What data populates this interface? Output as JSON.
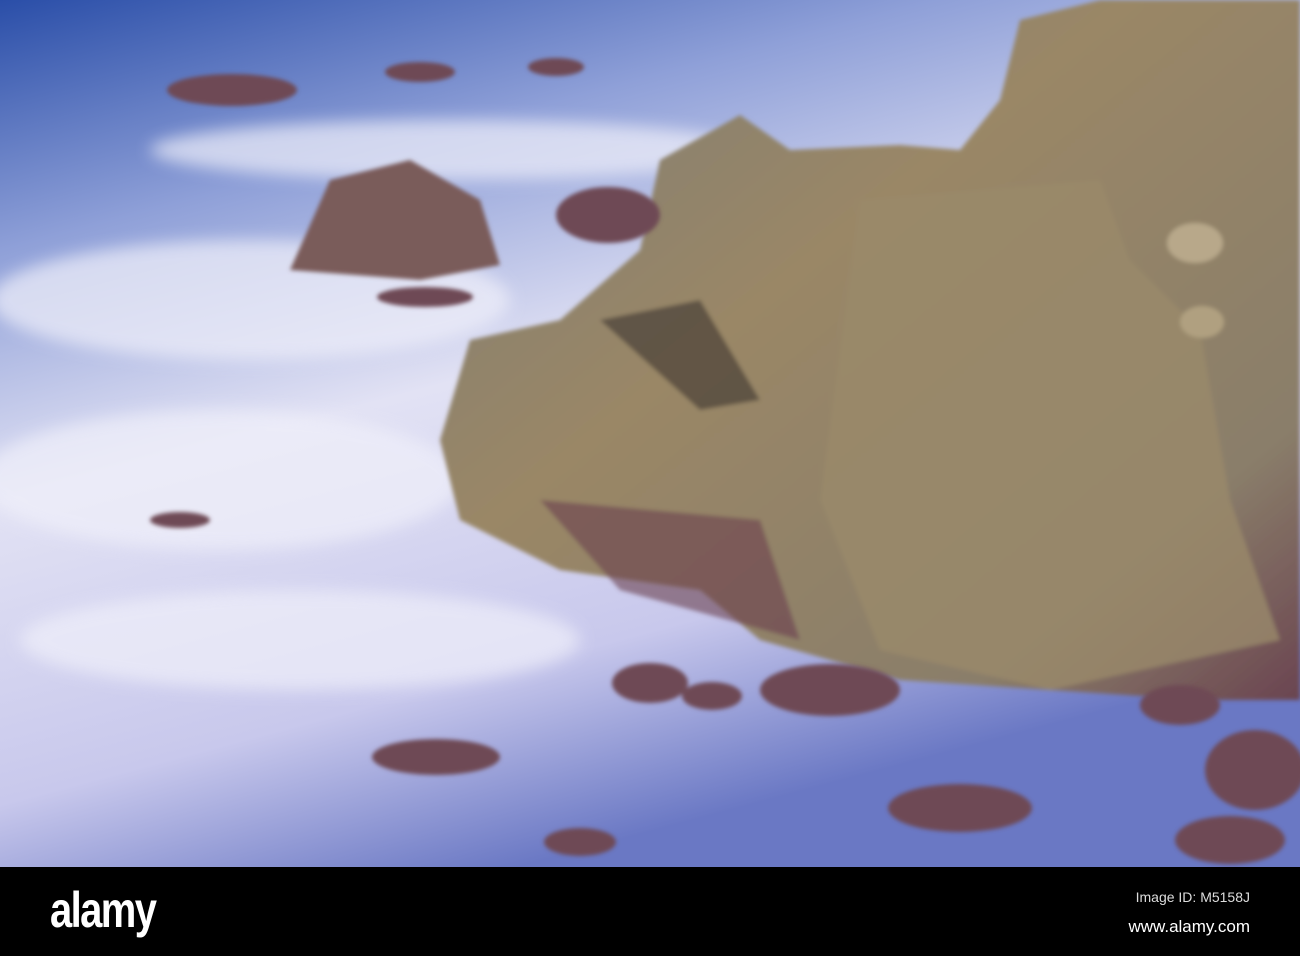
{
  "watermark": {
    "logo": "alamy",
    "image_id": "Image ID: M5158J",
    "url": "www.alamy.com"
  },
  "colors": {
    "sea": "#2f52a8",
    "foam": "#dcdcf2",
    "rock": "#8a7a5e",
    "rock_dark": "#6b4550",
    "bar": "#000000"
  }
}
